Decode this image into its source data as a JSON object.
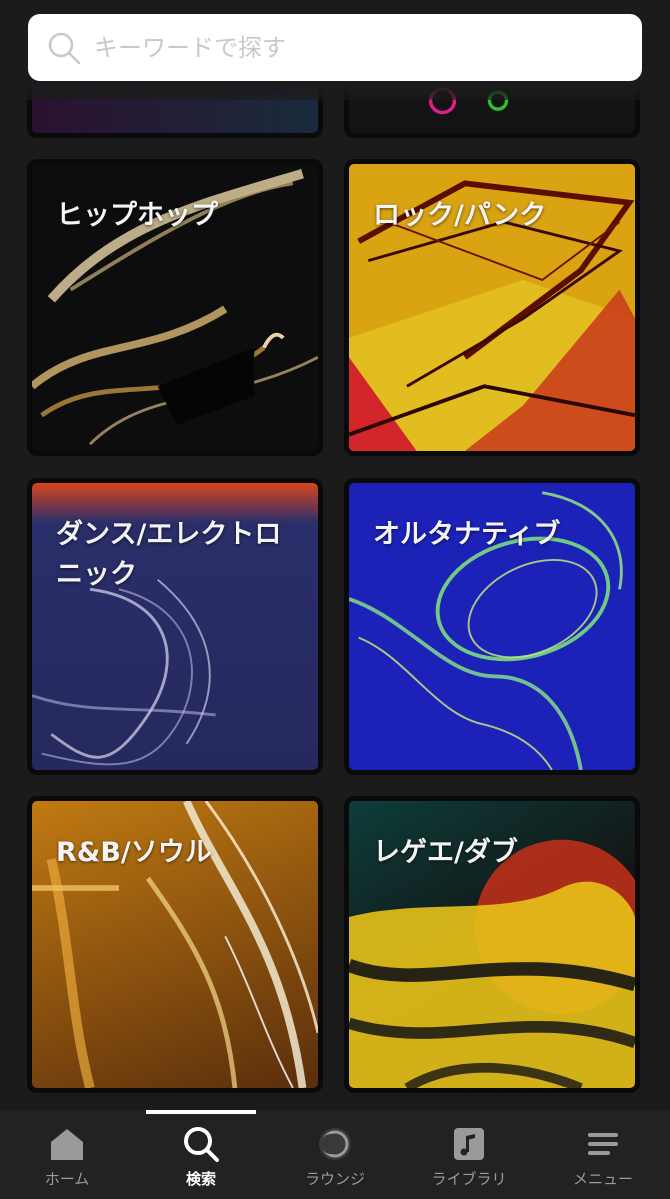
{
  "search": {
    "placeholder": "キーワードで探す"
  },
  "genres": [
    {
      "label": "ヒップホップ"
    },
    {
      "label": "ロック/パンク"
    },
    {
      "label": "ダンス/エレクトロニック"
    },
    {
      "label": "オルタナティブ"
    },
    {
      "label": "R&B/ソウル"
    },
    {
      "label": "レゲエ/ダブ"
    }
  ],
  "nav": [
    {
      "label": "ホーム",
      "icon": "home-icon"
    },
    {
      "label": "検索",
      "icon": "search-icon",
      "active": true
    },
    {
      "label": "ラウンジ",
      "icon": "lounge-icon"
    },
    {
      "label": "ライブラリ",
      "icon": "library-icon"
    },
    {
      "label": "メニュー",
      "icon": "menu-icon"
    }
  ],
  "colors": {
    "background": "#1b1b1b",
    "nav_background": "#222222",
    "active": "#ffffff",
    "inactive": "#9a9a9a"
  }
}
